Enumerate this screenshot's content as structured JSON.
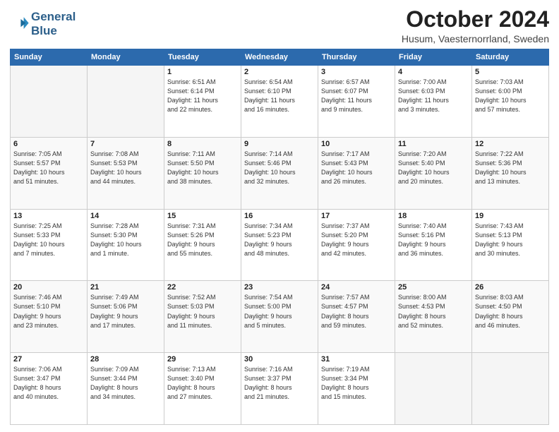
{
  "header": {
    "logo_line1": "General",
    "logo_line2": "Blue",
    "month": "October 2024",
    "location": "Husum, Vaesternorrland, Sweden"
  },
  "weekdays": [
    "Sunday",
    "Monday",
    "Tuesday",
    "Wednesday",
    "Thursday",
    "Friday",
    "Saturday"
  ],
  "weeks": [
    [
      {
        "day": "",
        "info": ""
      },
      {
        "day": "",
        "info": ""
      },
      {
        "day": "1",
        "info": "Sunrise: 6:51 AM\nSunset: 6:14 PM\nDaylight: 11 hours\nand 22 minutes."
      },
      {
        "day": "2",
        "info": "Sunrise: 6:54 AM\nSunset: 6:10 PM\nDaylight: 11 hours\nand 16 minutes."
      },
      {
        "day": "3",
        "info": "Sunrise: 6:57 AM\nSunset: 6:07 PM\nDaylight: 11 hours\nand 9 minutes."
      },
      {
        "day": "4",
        "info": "Sunrise: 7:00 AM\nSunset: 6:03 PM\nDaylight: 11 hours\nand 3 minutes."
      },
      {
        "day": "5",
        "info": "Sunrise: 7:03 AM\nSunset: 6:00 PM\nDaylight: 10 hours\nand 57 minutes."
      }
    ],
    [
      {
        "day": "6",
        "info": "Sunrise: 7:05 AM\nSunset: 5:57 PM\nDaylight: 10 hours\nand 51 minutes."
      },
      {
        "day": "7",
        "info": "Sunrise: 7:08 AM\nSunset: 5:53 PM\nDaylight: 10 hours\nand 44 minutes."
      },
      {
        "day": "8",
        "info": "Sunrise: 7:11 AM\nSunset: 5:50 PM\nDaylight: 10 hours\nand 38 minutes."
      },
      {
        "day": "9",
        "info": "Sunrise: 7:14 AM\nSunset: 5:46 PM\nDaylight: 10 hours\nand 32 minutes."
      },
      {
        "day": "10",
        "info": "Sunrise: 7:17 AM\nSunset: 5:43 PM\nDaylight: 10 hours\nand 26 minutes."
      },
      {
        "day": "11",
        "info": "Sunrise: 7:20 AM\nSunset: 5:40 PM\nDaylight: 10 hours\nand 20 minutes."
      },
      {
        "day": "12",
        "info": "Sunrise: 7:22 AM\nSunset: 5:36 PM\nDaylight: 10 hours\nand 13 minutes."
      }
    ],
    [
      {
        "day": "13",
        "info": "Sunrise: 7:25 AM\nSunset: 5:33 PM\nDaylight: 10 hours\nand 7 minutes."
      },
      {
        "day": "14",
        "info": "Sunrise: 7:28 AM\nSunset: 5:30 PM\nDaylight: 10 hours\nand 1 minute."
      },
      {
        "day": "15",
        "info": "Sunrise: 7:31 AM\nSunset: 5:26 PM\nDaylight: 9 hours\nand 55 minutes."
      },
      {
        "day": "16",
        "info": "Sunrise: 7:34 AM\nSunset: 5:23 PM\nDaylight: 9 hours\nand 48 minutes."
      },
      {
        "day": "17",
        "info": "Sunrise: 7:37 AM\nSunset: 5:20 PM\nDaylight: 9 hours\nand 42 minutes."
      },
      {
        "day": "18",
        "info": "Sunrise: 7:40 AM\nSunset: 5:16 PM\nDaylight: 9 hours\nand 36 minutes."
      },
      {
        "day": "19",
        "info": "Sunrise: 7:43 AM\nSunset: 5:13 PM\nDaylight: 9 hours\nand 30 minutes."
      }
    ],
    [
      {
        "day": "20",
        "info": "Sunrise: 7:46 AM\nSunset: 5:10 PM\nDaylight: 9 hours\nand 23 minutes."
      },
      {
        "day": "21",
        "info": "Sunrise: 7:49 AM\nSunset: 5:06 PM\nDaylight: 9 hours\nand 17 minutes."
      },
      {
        "day": "22",
        "info": "Sunrise: 7:52 AM\nSunset: 5:03 PM\nDaylight: 9 hours\nand 11 minutes."
      },
      {
        "day": "23",
        "info": "Sunrise: 7:54 AM\nSunset: 5:00 PM\nDaylight: 9 hours\nand 5 minutes."
      },
      {
        "day": "24",
        "info": "Sunrise: 7:57 AM\nSunset: 4:57 PM\nDaylight: 8 hours\nand 59 minutes."
      },
      {
        "day": "25",
        "info": "Sunrise: 8:00 AM\nSunset: 4:53 PM\nDaylight: 8 hours\nand 52 minutes."
      },
      {
        "day": "26",
        "info": "Sunrise: 8:03 AM\nSunset: 4:50 PM\nDaylight: 8 hours\nand 46 minutes."
      }
    ],
    [
      {
        "day": "27",
        "info": "Sunrise: 7:06 AM\nSunset: 3:47 PM\nDaylight: 8 hours\nand 40 minutes."
      },
      {
        "day": "28",
        "info": "Sunrise: 7:09 AM\nSunset: 3:44 PM\nDaylight: 8 hours\nand 34 minutes."
      },
      {
        "day": "29",
        "info": "Sunrise: 7:13 AM\nSunset: 3:40 PM\nDaylight: 8 hours\nand 27 minutes."
      },
      {
        "day": "30",
        "info": "Sunrise: 7:16 AM\nSunset: 3:37 PM\nDaylight: 8 hours\nand 21 minutes."
      },
      {
        "day": "31",
        "info": "Sunrise: 7:19 AM\nSunset: 3:34 PM\nDaylight: 8 hours\nand 15 minutes."
      },
      {
        "day": "",
        "info": ""
      },
      {
        "day": "",
        "info": ""
      }
    ]
  ]
}
